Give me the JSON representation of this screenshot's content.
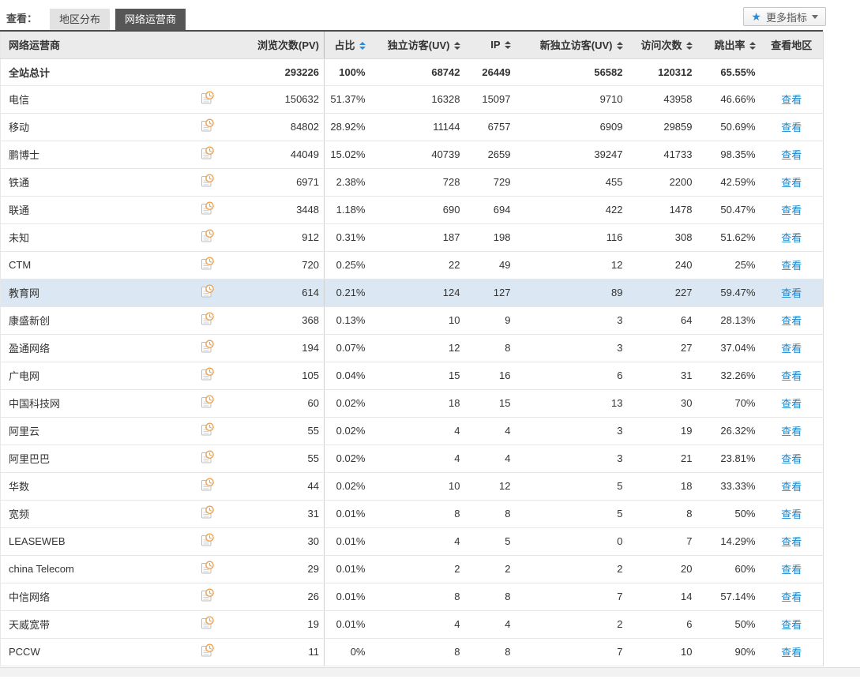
{
  "toolbar": {
    "view_label": "查看：",
    "tabs": [
      {
        "id": "region-distribution",
        "label": "地区分布",
        "active": false
      },
      {
        "id": "network-operator",
        "label": "网络运营商",
        "active": true
      }
    ],
    "more_metrics": {
      "star": "★",
      "label": "更多指标"
    }
  },
  "colors": {
    "link_blue": "#1b85c9",
    "active_sort_blue": "#2a8bd6",
    "icon_orange": "#f0a14b",
    "highlight_row": "#dbe8f3",
    "active_tab_bg": "#565656"
  },
  "table": {
    "columns": [
      {
        "id": "name",
        "label": "网络运营商",
        "align": "left",
        "sortable": false
      },
      {
        "id": "trend",
        "label": "",
        "align": "center",
        "sortable": false
      },
      {
        "id": "pv",
        "label": "浏览次数(PV)",
        "align": "right",
        "sortable": false
      },
      {
        "id": "share",
        "label": "占比",
        "align": "right",
        "sortable": true,
        "sort_active": true,
        "divider": true
      },
      {
        "id": "uv",
        "label": "独立访客(UV)",
        "align": "right",
        "sortable": true
      },
      {
        "id": "ip",
        "label": "IP",
        "align": "right",
        "sortable": true
      },
      {
        "id": "new_uv",
        "label": "新独立访客(UV)",
        "align": "right",
        "sortable": true
      },
      {
        "id": "visits",
        "label": "访问次数",
        "align": "right",
        "sortable": true
      },
      {
        "id": "bounce",
        "label": "跳出率",
        "align": "right",
        "sortable": true
      },
      {
        "id": "region",
        "label": "查看地区",
        "align": "center",
        "sortable": false
      }
    ],
    "view_link_label": "查看",
    "total": {
      "name": "全站总计",
      "pv": "293226",
      "share": "100%",
      "uv": "68742",
      "ip": "26449",
      "new_uv": "56582",
      "visits": "120312",
      "bounce": "65.55%"
    },
    "rows": [
      {
        "name": "电信",
        "pv": "150632",
        "share": "51.37%",
        "uv": "16328",
        "ip": "15097",
        "new_uv": "9710",
        "visits": "43958",
        "bounce": "46.66%"
      },
      {
        "name": "移动",
        "pv": "84802",
        "share": "28.92%",
        "uv": "11144",
        "ip": "6757",
        "new_uv": "6909",
        "visits": "29859",
        "bounce": "50.69%"
      },
      {
        "name": "鹏博士",
        "pv": "44049",
        "share": "15.02%",
        "uv": "40739",
        "ip": "2659",
        "new_uv": "39247",
        "visits": "41733",
        "bounce": "98.35%"
      },
      {
        "name": "铁通",
        "pv": "6971",
        "share": "2.38%",
        "uv": "728",
        "ip": "729",
        "new_uv": "455",
        "visits": "2200",
        "bounce": "42.59%"
      },
      {
        "name": "联通",
        "pv": "3448",
        "share": "1.18%",
        "uv": "690",
        "ip": "694",
        "new_uv": "422",
        "visits": "1478",
        "bounce": "50.47%"
      },
      {
        "name": "未知",
        "pv": "912",
        "share": "0.31%",
        "uv": "187",
        "ip": "198",
        "new_uv": "116",
        "visits": "308",
        "bounce": "51.62%"
      },
      {
        "name": "CTM",
        "pv": "720",
        "share": "0.25%",
        "uv": "22",
        "ip": "49",
        "new_uv": "12",
        "visits": "240",
        "bounce": "25%"
      },
      {
        "name": "教育网",
        "pv": "614",
        "share": "0.21%",
        "uv": "124",
        "ip": "127",
        "new_uv": "89",
        "visits": "227",
        "bounce": "59.47%",
        "highlighted": true
      },
      {
        "name": "康盛新创",
        "pv": "368",
        "share": "0.13%",
        "uv": "10",
        "ip": "9",
        "new_uv": "3",
        "visits": "64",
        "bounce": "28.13%"
      },
      {
        "name": "盈通网络",
        "pv": "194",
        "share": "0.07%",
        "uv": "12",
        "ip": "8",
        "new_uv": "3",
        "visits": "27",
        "bounce": "37.04%"
      },
      {
        "name": "广电网",
        "pv": "105",
        "share": "0.04%",
        "uv": "15",
        "ip": "16",
        "new_uv": "6",
        "visits": "31",
        "bounce": "32.26%"
      },
      {
        "name": "中国科技网",
        "pv": "60",
        "share": "0.02%",
        "uv": "18",
        "ip": "15",
        "new_uv": "13",
        "visits": "30",
        "bounce": "70%"
      },
      {
        "name": "阿里云",
        "pv": "55",
        "share": "0.02%",
        "uv": "4",
        "ip": "4",
        "new_uv": "3",
        "visits": "19",
        "bounce": "26.32%"
      },
      {
        "name": "阿里巴巴",
        "pv": "55",
        "share": "0.02%",
        "uv": "4",
        "ip": "4",
        "new_uv": "3",
        "visits": "21",
        "bounce": "23.81%"
      },
      {
        "name": "华数",
        "pv": "44",
        "share": "0.02%",
        "uv": "10",
        "ip": "12",
        "new_uv": "5",
        "visits": "18",
        "bounce": "33.33%"
      },
      {
        "name": "宽频",
        "pv": "31",
        "share": "0.01%",
        "uv": "8",
        "ip": "8",
        "new_uv": "5",
        "visits": "8",
        "bounce": "50%"
      },
      {
        "name": "LEASEWEB",
        "pv": "30",
        "share": "0.01%",
        "uv": "4",
        "ip": "5",
        "new_uv": "0",
        "visits": "7",
        "bounce": "14.29%"
      },
      {
        "name": "china Telecom",
        "pv": "29",
        "share": "0.01%",
        "uv": "2",
        "ip": "2",
        "new_uv": "2",
        "visits": "20",
        "bounce": "60%"
      },
      {
        "name": "中信网络",
        "pv": "26",
        "share": "0.01%",
        "uv": "8",
        "ip": "8",
        "new_uv": "7",
        "visits": "14",
        "bounce": "57.14%"
      },
      {
        "name": "天威宽带",
        "pv": "19",
        "share": "0.01%",
        "uv": "4",
        "ip": "4",
        "new_uv": "2",
        "visits": "6",
        "bounce": "50%"
      },
      {
        "name": "PCCW",
        "pv": "11",
        "share": "0%",
        "uv": "8",
        "ip": "8",
        "new_uv": "7",
        "visits": "10",
        "bounce": "90%"
      }
    ]
  }
}
